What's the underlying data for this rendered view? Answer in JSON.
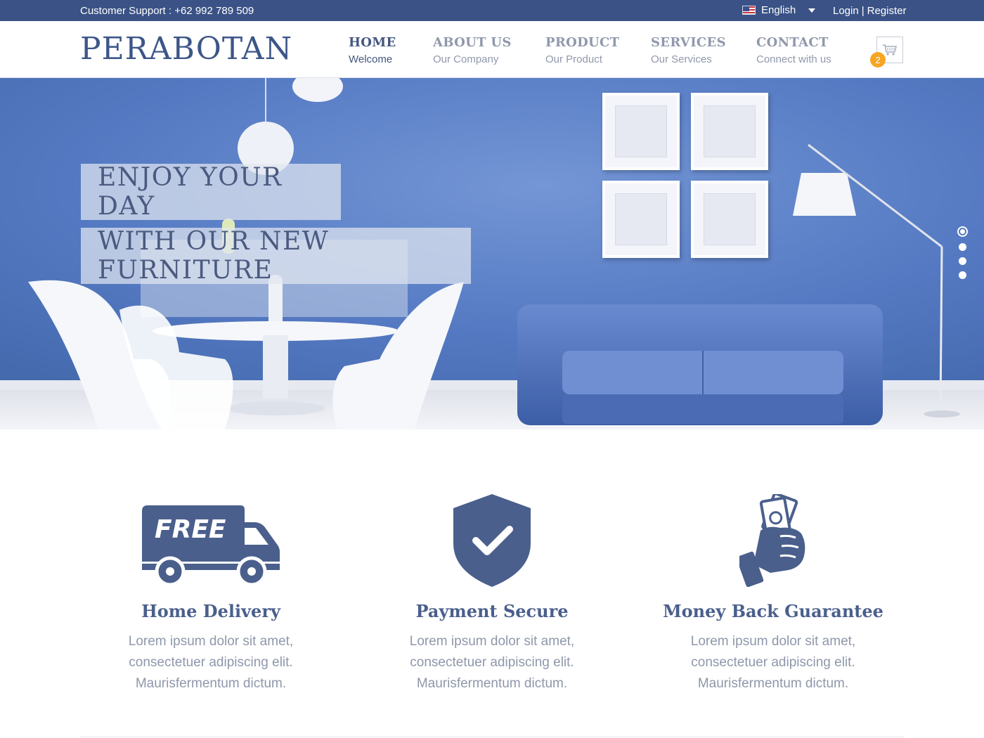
{
  "topbar": {
    "support": "Customer Support : +62 992 789 509",
    "language": "English",
    "login": "Login",
    "separator": "|",
    "register": "Register"
  },
  "logo": "PERABOTAN",
  "nav": [
    {
      "title": "HOME",
      "subtitle": "Welcome"
    },
    {
      "title": "ABOUT US",
      "subtitle": "Our Company"
    },
    {
      "title": "PRODUCT",
      "subtitle": "Our Product"
    },
    {
      "title": "SERVICES",
      "subtitle": "Our Services"
    },
    {
      "title": "CONTACT",
      "subtitle": "Connect with us"
    }
  ],
  "cart": {
    "count": "2",
    "icon": "cart-icon"
  },
  "hero": {
    "line1": "ENJOY YOUR DAY",
    "line2": "WITH OUR NEW FURNITURE",
    "slides": 4,
    "active_slide": 1
  },
  "features": [
    {
      "title": "Home Delivery",
      "text": "Lorem ipsum dolor sit amet, consectetuer adipiscing elit. Maurisfermentum dictum.",
      "icon": "free-delivery-truck-icon",
      "icon_label": "FREE"
    },
    {
      "title": "Payment Secure",
      "text": "Lorem ipsum dolor sit amet, consectetuer adipiscing elit. Maurisfermentum dictum.",
      "icon": "shield-check-icon"
    },
    {
      "title": "Money Back Guarantee",
      "text": "Lorem ipsum dolor sit amet, consectetuer adipiscing elit. Maurisfermentum dictum.",
      "icon": "hand-money-icon"
    }
  ],
  "colors": {
    "primary": "#3a5285",
    "accent": "#f6a623",
    "muted": "#9098ab"
  }
}
